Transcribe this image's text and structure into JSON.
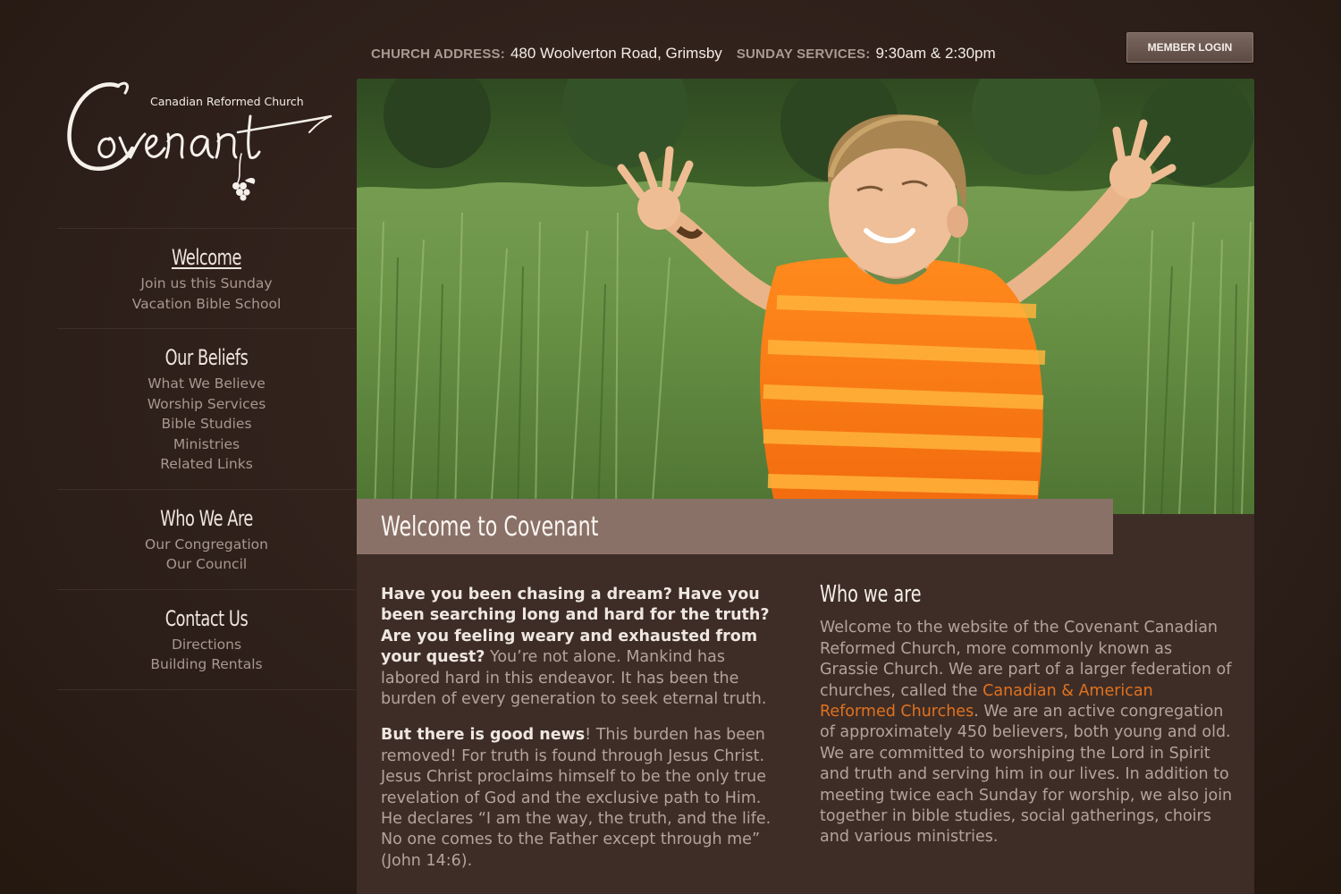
{
  "colors": {
    "background": "#2e1f1a",
    "panel": "#3e2d27",
    "welcome_bar": "#8a7168",
    "link": "#e0721e"
  },
  "header": {
    "address_label": "CHURCH ADDRESS:",
    "address_value": "480 Woolverton Road, Grimsby",
    "services_label": "SUNDAY SERVICES:",
    "services_value": "9:30am & 2:30pm",
    "login_label": "MEMBER LOGIN"
  },
  "logo": {
    "tagline": "Canadian Reformed Church",
    "name": "Covenant"
  },
  "sidebar": {
    "groups": [
      {
        "heading": "Welcome",
        "items": [
          "Join us this Sunday",
          "Vacation Bible School"
        ]
      },
      {
        "heading": "Our Beliefs",
        "items": [
          "What We Believe",
          "Worship Services",
          "Bible Studies",
          "Ministries",
          "Related Links"
        ]
      },
      {
        "heading": "Who We Are",
        "items": [
          "Our Congregation",
          "Our Council"
        ]
      },
      {
        "heading": "Contact Us",
        "items": [
          "Directions",
          "Building Rentals"
        ]
      }
    ]
  },
  "hero": {
    "icon": "hero-photo-boy-in-wheat-field"
  },
  "main": {
    "title": "Welcome to Covenant",
    "left": {
      "p1_bold": "Have you been chasing a dream? Have you been searching long and hard for the truth? Are you feeling weary and exhausted from your quest?",
      "p1_rest": " You’re not alone. Mankind has labored hard in this endeavor. It has been the burden of every generation to seek eternal truth.",
      "p2_bold": "But there is good news",
      "p2_rest": "! This burden has been removed! For truth is found through Jesus Christ. Jesus Christ proclaims himself to be the only true revelation of God and the exclusive path to Him. He declares “I am the way, the truth, and the life. No one comes to the Father except through me” (John 14:6)."
    },
    "right": {
      "heading": "Who we are",
      "text_before_link": "Welcome to the website of the Covenant Canadian Reformed Church, more commonly known as Grassie Church. We are part of a larger federation of churches, called the ",
      "link": "Canadian & American Reformed Churches",
      "text_after_link": ". We are an active congregation of approximately 450 believers, both young and old. We are committed to worshiping the Lord in Spirit and truth and serving him in our lives. In addition to meeting twice each Sunday for worship, we also join together in bible studies, social gatherings, choirs and various ministries."
    }
  }
}
